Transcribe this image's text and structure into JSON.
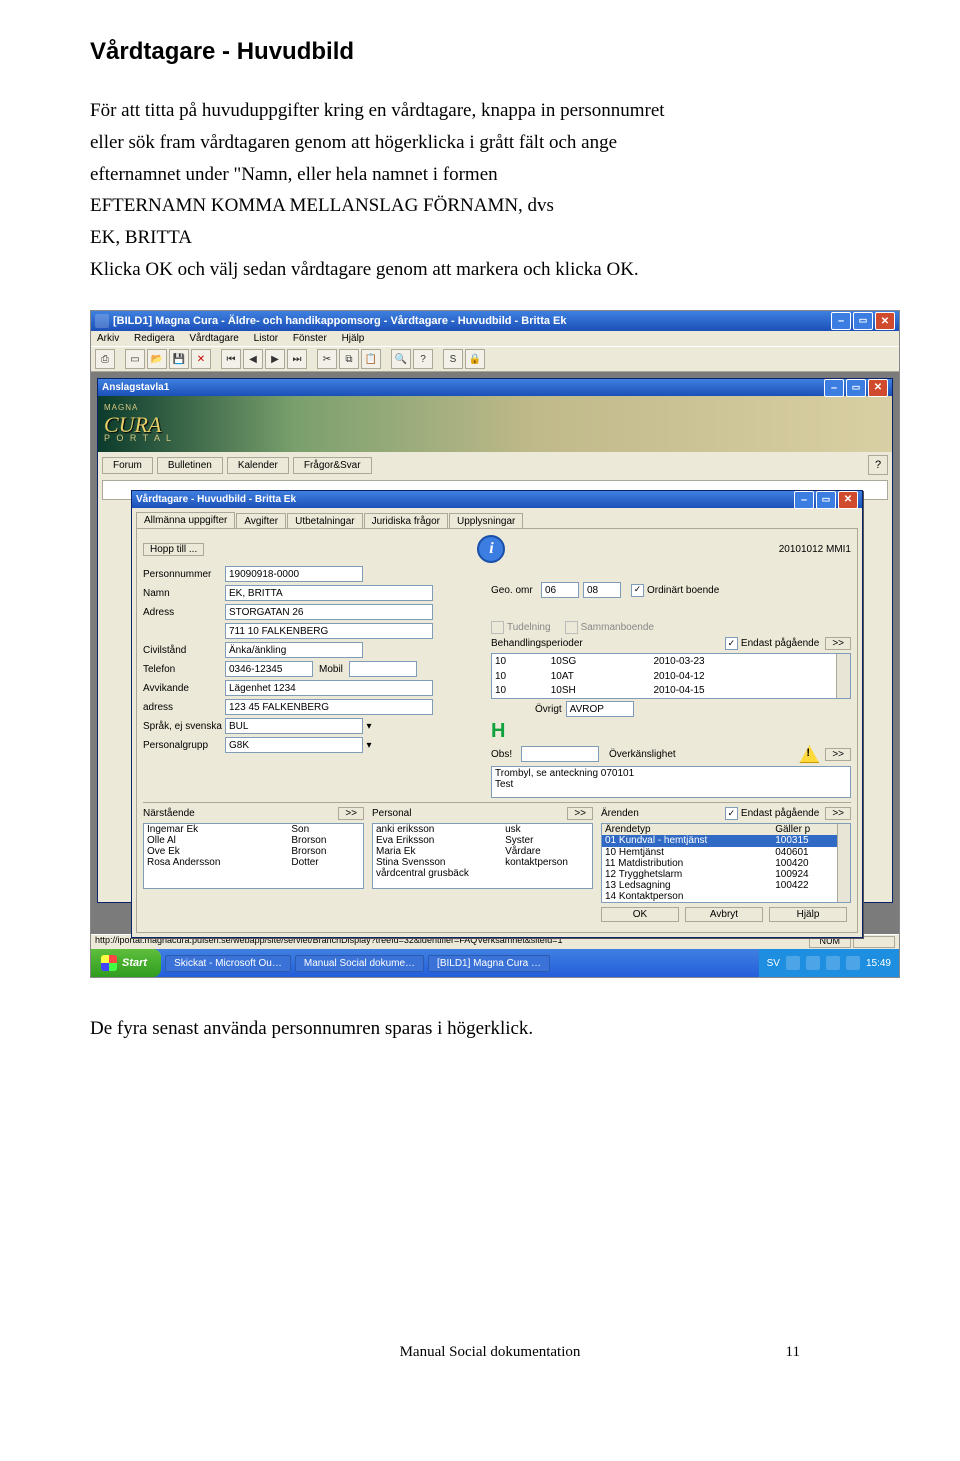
{
  "heading": "Vårdtagare - Huvudbild",
  "para_lines": [
    "För att titta på huvuduppgifter kring en vårdtagare, knappa in personnumret",
    "eller sök fram vårdtagaren genom att högerklicka i grått fält och ange",
    "efternamnet under \"Namn, eller hela namnet i formen",
    "EFTERNAMN KOMMA MELLANSLAG FÖRNAMN, dvs",
    "EK, BRITTA",
    "Klicka OK och välj sedan vårdtagare genom att markera och klicka OK."
  ],
  "para2": "De fyra senast använda personnumren sparas i högerklick.",
  "footer": {
    "center": "Manual Social dokumentation",
    "page": "11"
  },
  "ss": {
    "outer_title": "[BILD1] Magna Cura - Äldre- och handikappomsorg - Vårdtagare - Huvudbild - Britta Ek",
    "menus": [
      "Arkiv",
      "Redigera",
      "Vårdtagare",
      "Listor",
      "Fönster",
      "Hjälp"
    ],
    "anslag_title": "Anslagstavla1",
    "portal_logo_top": "MAGNA",
    "portal_logo_main": "CURA",
    "portal_logo_sub": "P O R T A L",
    "portal_tabs": [
      "Forum",
      "Bulletinen",
      "Kalender",
      "Frågor&Svar"
    ],
    "vwin_title": "Vårdtagare - Huvudbild - Britta Ek",
    "tabs": [
      "Allmänna uppgifter",
      "Avgifter",
      "Utbetalningar",
      "Juridiska frågor",
      "Upplysningar"
    ],
    "hopp": "Hopp till ...",
    "date_user": "20101012    MMI1",
    "fields": {
      "personnummer_lbl": "Personnummer",
      "personnummer": "19090918-0000",
      "namn_lbl": "Namn",
      "namn": "EK, BRITTA",
      "adress_lbl": "Adress",
      "adress": "STORGATAN 26",
      "post": "711 10   FALKENBERG",
      "civil_lbl": "Civilstånd",
      "civil": "Änka/änkling",
      "telefon_lbl": "Telefon",
      "telefon": "0346-12345",
      "mobil_lbl": "Mobil",
      "mobil": "",
      "ovrigt_lbl": "Övrigt",
      "ovrigt": "AVROP",
      "avvik_lbl": "Avvikande",
      "avvik": "Lägenhet 1234",
      "adress2_lbl": "adress",
      "adress2": "123 45   FALKENBERG",
      "sprak_lbl": "Språk, ej svenska",
      "sprak": "BUL",
      "pgrupp_lbl": "Personalgrupp",
      "pgrupp": "G8K",
      "geo_lbl": "Geo. omr",
      "geo1": "06",
      "geo2": "08",
      "ordbo_lbl": "Ordinärt boende",
      "tudel_lbl": "Tudelning",
      "samman_lbl": "Sammanboende",
      "behper_lbl": "Behandlingsperioder",
      "endast_lbl": "Endast pågående",
      "obs_lbl": "Obs!",
      "overk_lbl": "Överkänslighet",
      "overk_text": "Trombyl, se anteckning 070101\nTest"
    },
    "behper": [
      {
        "a": "10",
        "b": "10SG",
        "c": "2010-03-23"
      },
      {
        "a": "10",
        "b": "10AT",
        "c": "2010-04-12"
      },
      {
        "a": "10",
        "b": "10SH",
        "c": "2010-04-15"
      }
    ],
    "narst_lbl": "Närstående",
    "narst": [
      {
        "n": "Ingemar Ek",
        "r": "Son"
      },
      {
        "n": "Olle Al",
        "r": "Brorson"
      },
      {
        "n": "Ove Ek",
        "r": "Brorson"
      },
      {
        "n": "Rosa Andersson",
        "r": "Dotter"
      }
    ],
    "personal_lbl": "Personal",
    "personal": [
      {
        "n": "anki eriksson",
        "r": "usk"
      },
      {
        "n": "Eva Eriksson",
        "r": "Syster"
      },
      {
        "n": "Maria Ek",
        "r": "Vårdare"
      },
      {
        "n": "Stina Svensson",
        "r": "kontaktperson"
      },
      {
        "n": "vårdcentral grusbäck",
        "r": ""
      }
    ],
    "arenden_lbl": "Ärenden",
    "arendetyp_lbl": "Ärendetyp",
    "galler_lbl": "Gäller p",
    "arenden": [
      {
        "t": "01 Kundval - hemtjänst",
        "d": "100315",
        "sel": true
      },
      {
        "t": "10 Hemtjänst",
        "d": "040601"
      },
      {
        "t": "11 Matdistribution",
        "d": "100420"
      },
      {
        "t": "12 Trygghetslarm",
        "d": "100924"
      },
      {
        "t": "13 Ledsagning",
        "d": "100422"
      },
      {
        "t": "14 Kontaktperson",
        "d": ""
      }
    ],
    "buttons": {
      "ok": "OK",
      "avbryt": "Avbryt",
      "hjalp": "Hjälp"
    },
    "url": "http://iportal.magnacura.pulsen.se/webapp/site/servlet/BranchDisplay?treeId=32&identifier=FAQVerksamhet&siteId=1",
    "status_right": "NUM",
    "task": {
      "start": "Start",
      "items": [
        "Skickat - Microsoft Ou…",
        "Manual Social dokume…",
        "[BILD1] Magna Cura …"
      ],
      "lang": "SV",
      "clock": "15:49"
    }
  }
}
